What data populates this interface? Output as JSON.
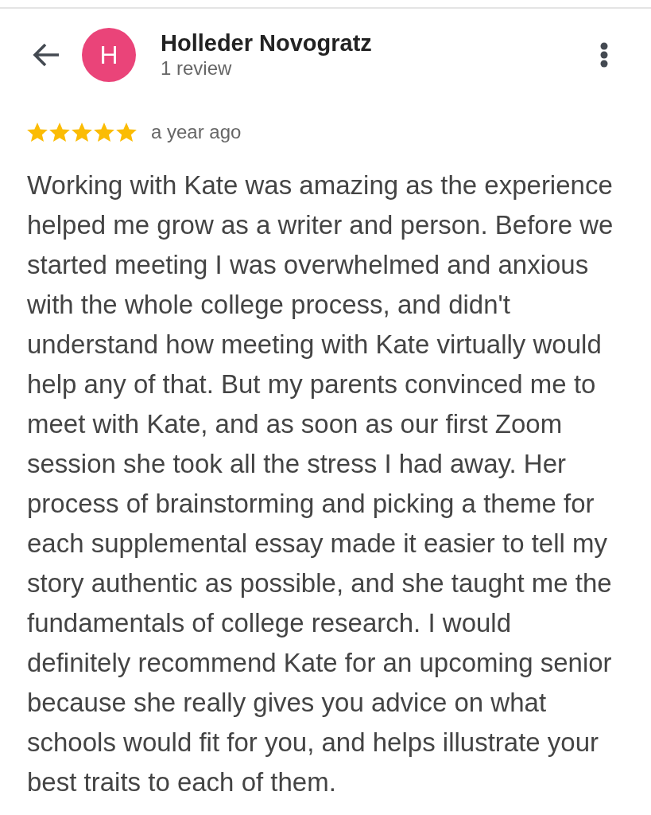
{
  "reviewer": {
    "initial": "H",
    "name": "Holleder Novogratz",
    "review_count": "1 review"
  },
  "review": {
    "stars": 5,
    "time": "a year ago",
    "text": "Working with Kate was amazing as the experience helped me grow as a writer and person. Before we started meeting I was overwhelmed and anxious with the whole college process, and didn't understand how meeting with Kate virtually would help any of that. But my parents convinced me to meet with Kate, and as soon as our first Zoom session she took all the stress I had away. Her process of brainstorming and picking a theme for each supplemental essay made it easier to tell my story authentic as possible, and she taught me the fundamentals of college research. I would definitely recommend Kate for an upcoming senior because she really gives you advice on what schools would fit for you, and helps illustrate your best traits to each of them."
  }
}
